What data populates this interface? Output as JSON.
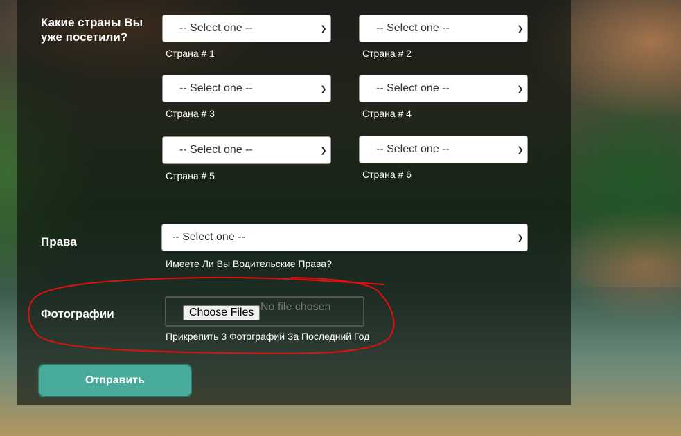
{
  "countries": {
    "label": "Какие страны Вы уже посетили?",
    "selects": [
      {
        "value": "-- Select one --",
        "hint": "Страна # 1"
      },
      {
        "value": "-- Select one --",
        "hint": "Страна # 2"
      },
      {
        "value": "-- Select one --",
        "hint": "Страна # 3"
      },
      {
        "value": "-- Select one --",
        "hint": "Страна # 4"
      },
      {
        "value": "-- Select one --",
        "hint": "Страна # 5"
      },
      {
        "value": "-- Select one --",
        "hint": "Страна # 6"
      }
    ]
  },
  "license": {
    "label": "Права",
    "value": "-- Select one --",
    "hint": "Имеете Ли Вы Водительские Права?"
  },
  "photos": {
    "label": "Фотографии",
    "button": "Choose Files",
    "status": "No file chosen",
    "hint": "Прикрепить 3 Фотографий За Последний Год"
  },
  "submit": "Отправить",
  "colors": {
    "accent": "#48ab9b",
    "annotation": "#e01010"
  },
  "icons": {
    "select_arrow": "chevron-down-icon"
  }
}
